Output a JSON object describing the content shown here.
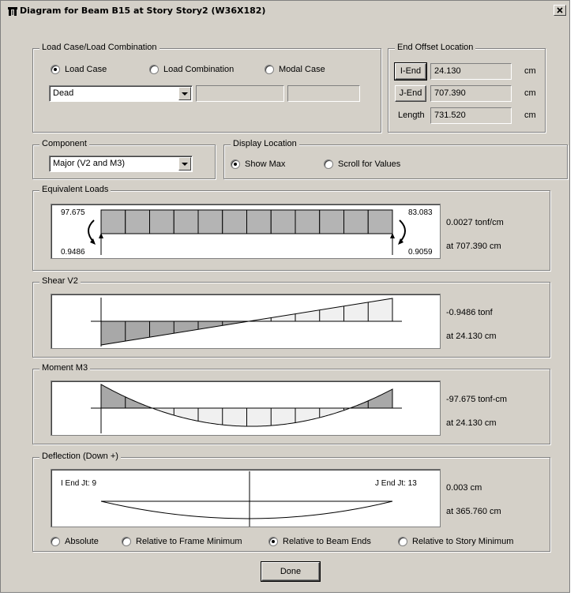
{
  "window": {
    "title": "Diagram for Beam B15 at Story Story2 (W36X182)",
    "close_label": "×"
  },
  "load_case": {
    "legend": "Load Case/Load Combination",
    "radios": [
      {
        "label": "Load Case",
        "checked": true
      },
      {
        "label": "Load Combination",
        "checked": false
      },
      {
        "label": "Modal Case",
        "checked": false
      }
    ],
    "selected": "Dead"
  },
  "end_offset": {
    "legend": "End Offset Location",
    "rows": [
      {
        "button": "I-End",
        "value": "24.130",
        "unit": "cm"
      },
      {
        "button": "J-End",
        "value": "707.390",
        "unit": "cm"
      },
      {
        "label": "Length",
        "value": "731.520",
        "unit": "cm"
      }
    ]
  },
  "component": {
    "legend": "Component",
    "selected": "Major (V2 and M3)"
  },
  "display_location": {
    "legend": "Display Location",
    "radios": [
      {
        "label": "Show Max",
        "checked": true
      },
      {
        "label": "Scroll for Values",
        "checked": false
      }
    ]
  },
  "equivalent_loads": {
    "legend": "Equivalent Loads",
    "left_moment": "97.675",
    "left_reaction": "0.9486",
    "right_moment": "83.083",
    "right_reaction": "0.9059",
    "info_line1": "0.0027 tonf/cm",
    "info_line2": "at 707.390 cm"
  },
  "shear": {
    "legend": "Shear V2",
    "info_line1": "-0.9486 tonf",
    "info_line2": "at 24.130 cm"
  },
  "moment": {
    "legend": "Moment M3",
    "info_line1": "-97.675 tonf-cm",
    "info_line2": "at 24.130 cm"
  },
  "deflection": {
    "legend": "Deflection (Down +)",
    "i_end": "I End Jt: 9",
    "j_end": "J End Jt: 13",
    "info_line1": "0.003 cm",
    "info_line2": "at 365.760 cm",
    "radios": [
      {
        "label": "Absolute",
        "checked": false
      },
      {
        "label": "Relative to Frame Minimum",
        "checked": false
      },
      {
        "label": "Relative to Beam Ends",
        "checked": true
      },
      {
        "label": "Relative to Story Minimum",
        "checked": false
      }
    ]
  },
  "done_label": "Done",
  "colors": {
    "dialog_bg": "#d4d0c8",
    "negative_fill": "#a8a8a8",
    "positive_fill": "#f0f0f0",
    "load_fill": "#b4b4b4"
  }
}
